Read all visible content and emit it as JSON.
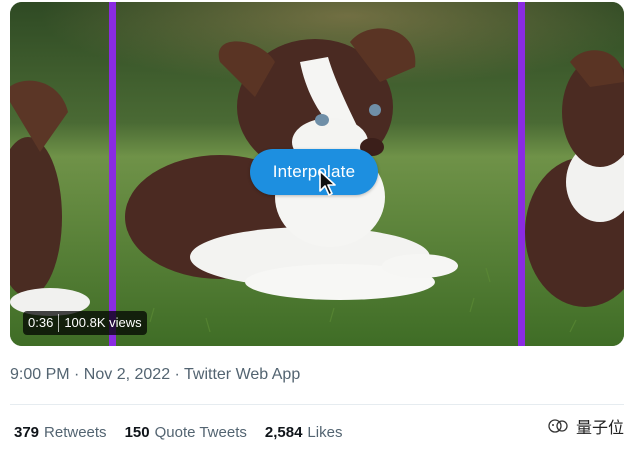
{
  "video": {
    "overlay_button_label": "Interpolate",
    "duration": "0:36",
    "views": "100.8K views",
    "divider_color": "#8a2be2"
  },
  "tweet": {
    "timestamp": "9:00 PM · Nov 2, 2022 · Twitter Web App",
    "stats": [
      {
        "count": "379",
        "label": "Retweets"
      },
      {
        "count": "150",
        "label": "Quote Tweets"
      },
      {
        "count": "2,584",
        "label": "Likes"
      }
    ]
  },
  "watermark": {
    "text": "量子位"
  },
  "colors": {
    "accent": "#1d8fe0",
    "muted_text": "#536471"
  }
}
